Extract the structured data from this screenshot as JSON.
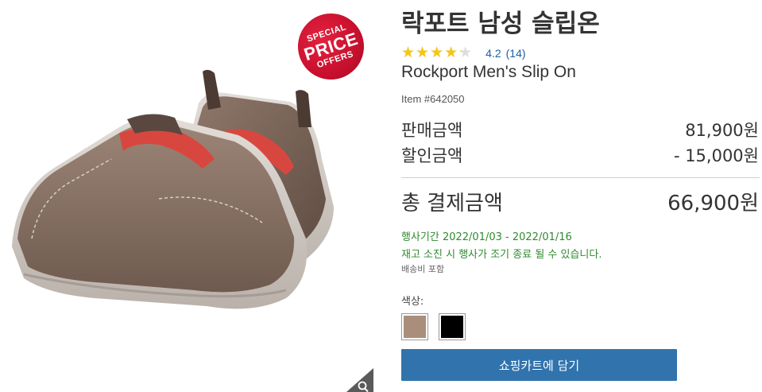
{
  "badge": {
    "line1": "SPECIAL",
    "line2": "PRICE",
    "line3": "OFFERS"
  },
  "product": {
    "title_ko": "락포트 남성 슬립온",
    "title_en": "Rockport Men's Slip On",
    "item_number": "Item #642050",
    "rating": {
      "value": 4.2,
      "value_text": "4.2",
      "count_text": "(14)",
      "max": 5
    }
  },
  "pricing": {
    "sale_label": "판매금액",
    "sale_value": "81,900원",
    "discount_label": "할인금액",
    "discount_value": "- 15,000원",
    "total_label": "총 결제금액",
    "total_value": "66,900원"
  },
  "promo": {
    "dates": "행사기간 2022/01/03 - 2022/01/16",
    "note": "재고 소진 시 행사가 조기 종료 될 수 있습니다.",
    "shipping": "배송비 포함"
  },
  "options": {
    "color_label": "색상:",
    "colors": [
      {
        "name": "taupe",
        "hex": "#a98e7c"
      },
      {
        "name": "black",
        "hex": "#000000"
      }
    ]
  },
  "actions": {
    "add_to_cart": "쇼핑카트에 담기"
  },
  "icons": {
    "zoom": "magnifier-icon",
    "stars": "star-icon"
  },
  "colors": {
    "accent": "#3173ad",
    "promo_text": "#2f8a2f",
    "badge_red": "#c8102e",
    "star": "#f5c518",
    "link": "#1a5fa5"
  }
}
